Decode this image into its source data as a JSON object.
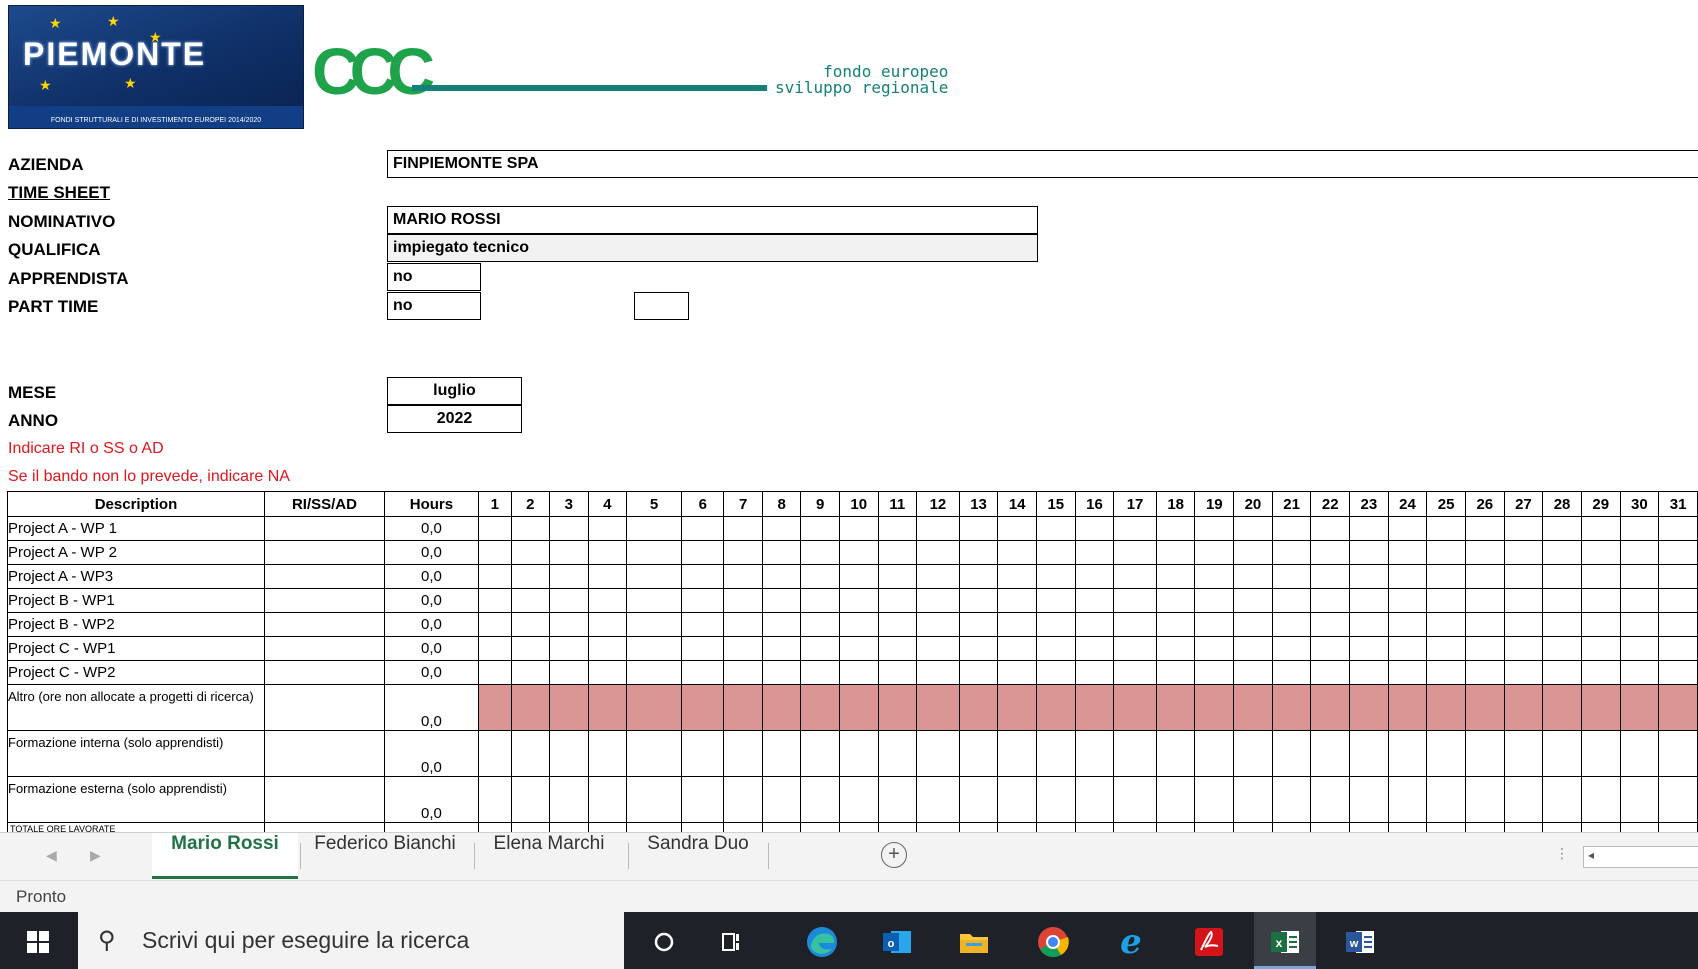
{
  "logos": {
    "piemonte_name": "PIEMONTE",
    "piemonte_sub": "FONDI STRUTTURALI E DI INVESTIMENTO EUROPEI 2014/2020",
    "ccc": "CCC",
    "fondo_line1": "fondo europeo",
    "fondo_line2": "sviluppo regionale"
  },
  "form": {
    "azienda_label": "AZIENDA",
    "azienda_value": "FINPIEMONTE SPA",
    "timesheet_label": "TIME SHEET",
    "nominativo_label": "NOMINATIVO",
    "nominativo_value": "MARIO ROSSI",
    "qualifica_label": "QUALIFICA",
    "qualifica_value": "impiegato tecnico",
    "apprendista_label": "APPRENDISTA",
    "apprendista_value": "no",
    "parttime_label": "PART TIME",
    "parttime_value": "no",
    "parttime_extra": "",
    "mese_label": "MESE",
    "mese_value": "luglio",
    "anno_label": "ANNO",
    "anno_value": "2022",
    "note1": "Indicare RI o SS o AD",
    "note2": "Se il bando non lo prevede, indicare NA"
  },
  "table": {
    "headers": {
      "description": "Description",
      "type": "RI/SS/AD",
      "hours": "Hours"
    },
    "days": [
      "1",
      "2",
      "3",
      "4",
      "5",
      "6",
      "7",
      "8",
      "9",
      "10",
      "11",
      "12",
      "13",
      "14",
      "15",
      "16",
      "17",
      "18",
      "19",
      "20",
      "21",
      "22",
      "23",
      "24",
      "25",
      "26",
      "27",
      "28",
      "29",
      "30",
      "31"
    ],
    "rows": [
      {
        "description": "Project A - WP 1",
        "type": "",
        "hours": "0,0"
      },
      {
        "description": "Project A - WP 2",
        "type": "",
        "hours": "0,0"
      },
      {
        "description": "Project A - WP3",
        "type": "",
        "hours": "0,0"
      },
      {
        "description": "Project B - WP1",
        "type": "",
        "hours": "0,0"
      },
      {
        "description": "Project B - WP2",
        "type": "",
        "hours": "0,0"
      },
      {
        "description": "Project C - WP1",
        "type": "",
        "hours": "0,0"
      },
      {
        "description": "Project C - WP2",
        "type": "",
        "hours": "0,0"
      },
      {
        "description": "Altro (ore non allocate a progetti di ricerca)",
        "type": "",
        "hours": "0,0"
      },
      {
        "description": "Formazione interna (solo apprendisti)",
        "type": "",
        "hours": "0,0"
      },
      {
        "description": "Formazione esterna (solo apprendisti)",
        "type": "",
        "hours": "0,0"
      }
    ],
    "total_label": "TOTALE ORE LAVORATE"
  },
  "sheet_tabs": [
    "Mario Rossi",
    "Federico Bianchi",
    "Elena Marchi",
    "Sandra Duo"
  ],
  "status": "Pronto",
  "taskbar": {
    "search_placeholder": "Scrivi qui per eseguire la ricerca"
  },
  "colors": {
    "excel_green": "#217346",
    "note_red": "#e0161b",
    "altro_fill": "#d99694"
  }
}
